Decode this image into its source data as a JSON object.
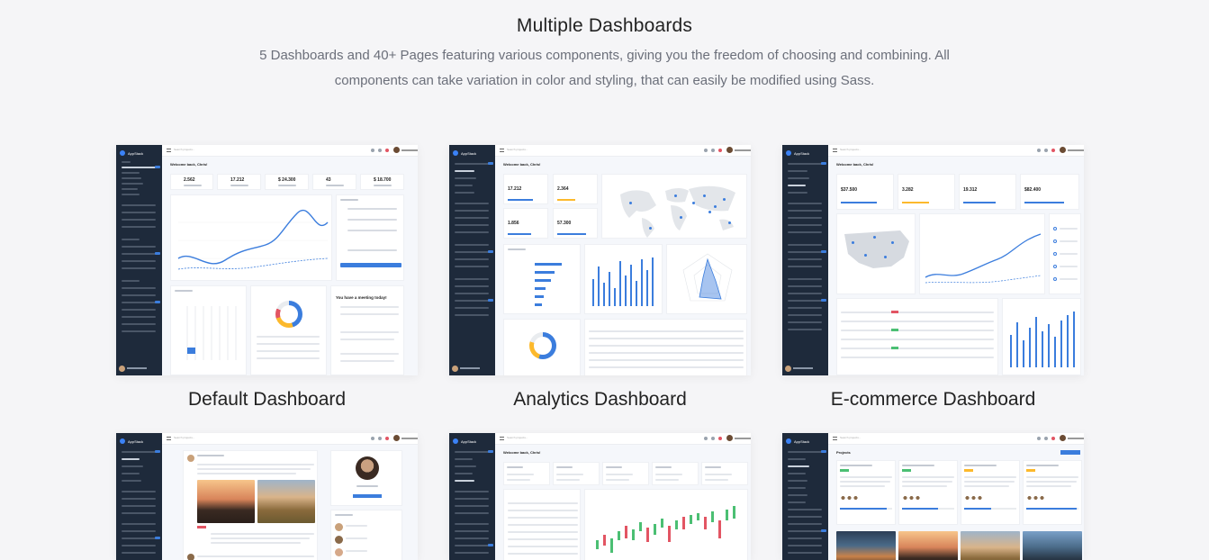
{
  "hero": {
    "title": "Multiple Dashboards",
    "description": "5 Dashboards and 40+ Pages featuring various components, giving you the freedom of choosing and combining. All components can take variation in color and styling, that can easily be modified using Sass."
  },
  "dashboards": [
    {
      "label": "Default Dashboard"
    },
    {
      "label": "Analytics Dashboard"
    },
    {
      "label": "E-commerce Dashboard"
    }
  ],
  "preview_text": {
    "brand": "AppStack",
    "search": "Search projects...",
    "welcome": "Welcome back, Chris!",
    "default_stats": [
      "2.562",
      "17.212",
      "$ 24.300",
      "43",
      "$ 18.700"
    ],
    "meeting": "You have a meeting today!",
    "analytics_stats": [
      "17.212",
      "2.364",
      "1.856",
      "57.300"
    ],
    "ecommerce_stats": [
      "$37.500",
      "3.282",
      "19.312",
      "$82.400"
    ],
    "projects": "Projects"
  },
  "colors": {
    "accent": "#3b7ddd",
    "sidebar": "#1e2a3b",
    "background": "#f5f5f7"
  }
}
